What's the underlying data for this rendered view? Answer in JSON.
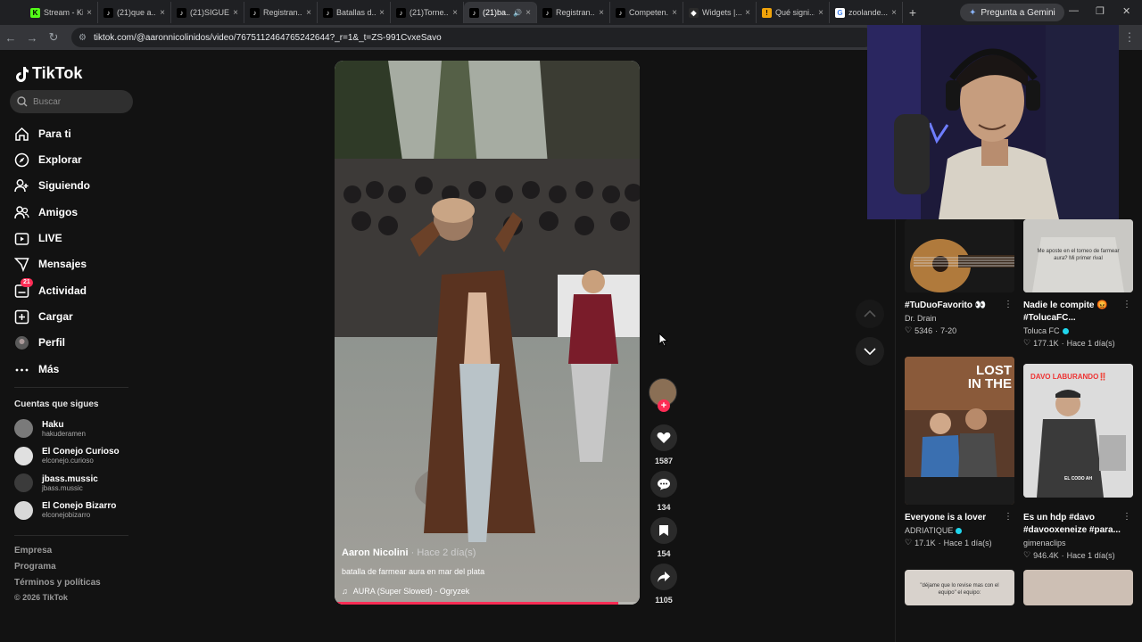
{
  "browser": {
    "tabs": [
      {
        "title": "Stream - Kick",
        "fav": "K",
        "favcolor": "#53fc18",
        "favtext": "#000"
      },
      {
        "title": "(21)que a...",
        "fav": "♪",
        "favcolor": "#000",
        "favtext": "#fff"
      },
      {
        "title": "(21)SIGUE...",
        "fav": "♪",
        "favcolor": "#000",
        "favtext": "#fff"
      },
      {
        "title": "Registran...",
        "fav": "♪",
        "favcolor": "#000",
        "favtext": "#fff"
      },
      {
        "title": "Batallas d...",
        "fav": "♪",
        "favcolor": "#000",
        "favtext": "#fff"
      },
      {
        "title": "(21)Torne...",
        "fav": "♪",
        "favcolor": "#000",
        "favtext": "#fff"
      },
      {
        "title": "(21)ba...",
        "fav": "♪",
        "favcolor": "#000",
        "favtext": "#fff"
      },
      {
        "title": "Registran...",
        "fav": "♪",
        "favcolor": "#000",
        "favtext": "#fff"
      },
      {
        "title": "Competen...",
        "fav": "♪",
        "favcolor": "#000",
        "favtext": "#fff"
      },
      {
        "title": "Widgets |...",
        "fav": "◆",
        "favcolor": "#2b2b2b",
        "favtext": "#fff"
      },
      {
        "title": "Qué signi...",
        "fav": "!",
        "favcolor": "#f0a30a",
        "favtext": "#000"
      },
      {
        "title": "zoolande...",
        "fav": "G",
        "favcolor": "#fff",
        "favtext": "#4285f4"
      }
    ],
    "gemini_label": "Pregunta a Gemini",
    "url": "tiktok.com/@aaronnicolinidos/video/7675112464765242644?_r=1&_t=ZS-991CvxeSavo"
  },
  "sidebar": {
    "logo": "TikTok",
    "search_placeholder": "Buscar",
    "nav": [
      {
        "label": "Para ti",
        "icon": "home-icon"
      },
      {
        "label": "Explorar",
        "icon": "compass-icon"
      },
      {
        "label": "Siguiendo",
        "icon": "following-icon"
      },
      {
        "label": "Amigos",
        "icon": "friends-icon"
      },
      {
        "label": "LIVE",
        "icon": "live-icon"
      },
      {
        "label": "Mensajes",
        "icon": "messages-icon"
      },
      {
        "label": "Actividad",
        "icon": "activity-icon",
        "badge": "21"
      },
      {
        "label": "Cargar",
        "icon": "upload-icon"
      },
      {
        "label": "Perfil",
        "icon": "profile-icon"
      },
      {
        "label": "Más",
        "icon": "more-icon"
      }
    ],
    "following_title": "Cuentas que sigues",
    "following": [
      {
        "name": "Haku",
        "handle": "hakuderamen"
      },
      {
        "name": "El Conejo Curioso",
        "handle": "elconejo.curioso"
      },
      {
        "name": "jbass.mussic",
        "handle": "jbass.mussic"
      },
      {
        "name": "El Conejo Bizarro",
        "handle": "elconejobizarro"
      }
    ],
    "footer": [
      "Empresa",
      "Programa",
      "Términos y políticas"
    ],
    "copyright": "© 2026 TikTok"
  },
  "video": {
    "author": "Aaron Nicolini",
    "time": "· Hace 2 día(s)",
    "description": "batalla de farmear aura en mar del plata",
    "music": "AURA (Super Slowed) - Ogryzek",
    "progress": 0.93
  },
  "actions": {
    "likes": "1587",
    "comments": "134",
    "saves": "154",
    "shares": "1105"
  },
  "grid": [
    {
      "title": "#TuDuoFavorito 👀",
      "channel": "Dr. Drain",
      "verified": false,
      "likes": "5346",
      "time": "7-20"
    },
    {
      "title": "Nadie le compite 😡 #TolucaFC...",
      "channel": "Toluca FC",
      "verified": true,
      "likes": "177.1K",
      "time": "Hace 1 día(s)",
      "overlay": "Me aposte en el torneo de farmear aura? Mi primer rival"
    },
    {
      "title": "Everyone is a lover",
      "channel": "ADRIATIQUE",
      "verified": true,
      "likes": "17.1K",
      "time": "Hace 1 día(s)",
      "overlay": "LOST IN THE"
    },
    {
      "title": "Es un hdp #davo #davooxeneize #para...",
      "channel": "gimenaclips",
      "verified": false,
      "likes": "946.4K",
      "time": "Hace 1 día(s)",
      "overlay": "DAVO LABURANDO‼️",
      "overlay2": "EL CODO AH"
    },
    {
      "overlay": "\"déjame que lo revise mas con el equipo\" el equipo:"
    }
  ]
}
